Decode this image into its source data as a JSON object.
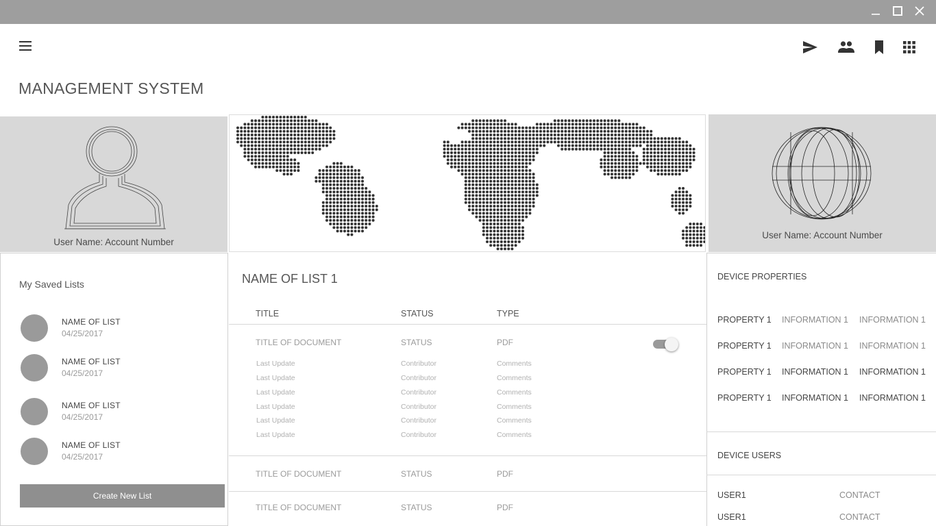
{
  "header": {
    "title": "MANAGEMENT SYSTEM",
    "menu_icon": "hamburger-menu-icon",
    "actions": [
      {
        "icon": "send-icon"
      },
      {
        "icon": "people-icon"
      },
      {
        "icon": "bookmark-icon"
      },
      {
        "icon": "apps-grid-icon"
      }
    ]
  },
  "window_controls": [
    "minimize-icon",
    "maximize-icon",
    "close-icon"
  ],
  "colors": {
    "titlebar": "#9e9e9e",
    "panel": "#d8d8d8",
    "avatar": "#9a9a9a",
    "button": "#8f8f8f",
    "map_dots": "#333333"
  },
  "hero": {
    "left_caption": "User Name: Account Number",
    "right_caption": "User Name: Account Number"
  },
  "saved_lists": {
    "title": "My Saved Lists",
    "items": [
      {
        "name": "NAME OF LIST",
        "date": "04/25/2017"
      },
      {
        "name": "NAME OF LIST",
        "date": "04/25/2017"
      },
      {
        "name": "NAME OF LIST",
        "date": "04/25/2017"
      },
      {
        "name": "NAME OF LIST",
        "date": "04/25/2017"
      }
    ],
    "create_button": "Create New List"
  },
  "list": {
    "title": "NAME OF LIST 1",
    "columns": [
      "TITLE",
      "STATUS",
      "TYPE"
    ],
    "rows": [
      {
        "title": "TITLE OF DOCUMENT",
        "status": "STATUS",
        "type": "PDF",
        "toggle_on": true,
        "details": [
          {
            "a": "Last Update",
            "b": "Contributor",
            "c": "Comments"
          },
          {
            "a": "Last Update",
            "b": "Contributor",
            "c": "Comments"
          },
          {
            "a": "Last Update",
            "b": "Contributor",
            "c": "Comments"
          },
          {
            "a": "Last Update",
            "b": "Contributor",
            "c": "Comments"
          },
          {
            "a": "Last Update",
            "b": "Contributor",
            "c": "Comments"
          },
          {
            "a": "Last Update",
            "b": "Contributor",
            "c": "Comments"
          }
        ]
      },
      {
        "title": "TITLE OF DOCUMENT",
        "status": "STATUS",
        "type": "PDF"
      },
      {
        "title": "TITLE OF DOCUMENT",
        "status": "STATUS",
        "type": "PDF"
      }
    ]
  },
  "device_properties": {
    "title": "DEVICE PROPERTIES",
    "rows": [
      {
        "property": "PROPERTY 1",
        "info1": "INFORMATION 1",
        "info2": "INFORMATION 1"
      },
      {
        "property": "PROPERTY 1",
        "info1": "INFORMATION 1",
        "info2": "INFORMATION 1"
      },
      {
        "property": "PROPERTY 1",
        "info1": "INFORMATION 1",
        "info2": "INFORMATION 1"
      },
      {
        "property": "PROPERTY 1",
        "info1": "INFORMATION 1",
        "info2": "INFORMATION 1"
      }
    ]
  },
  "device_users": {
    "title": "DEVICE USERS",
    "rows": [
      {
        "user": "USER1",
        "contact": "CONTACT"
      },
      {
        "user": "USER1",
        "contact": "CONTACT"
      }
    ]
  }
}
